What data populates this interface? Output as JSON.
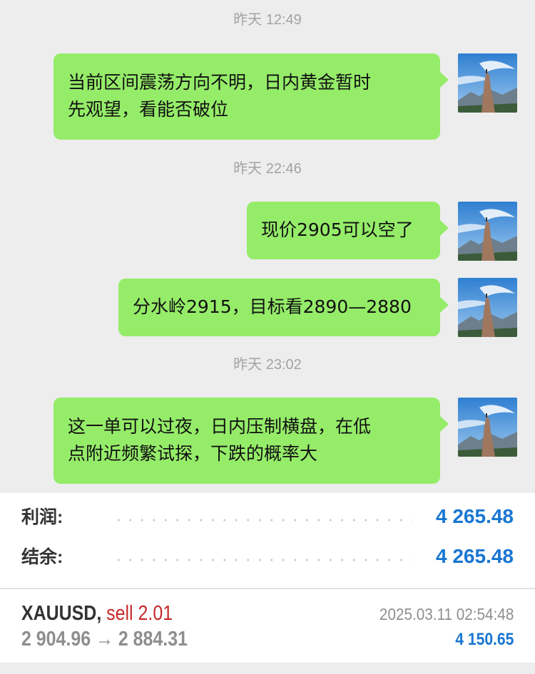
{
  "chat": {
    "timestamps": [
      "昨天 12:49",
      "昨天 22:46",
      "昨天 23:02"
    ],
    "messages": [
      {
        "lines": [
          "当前区间震荡方向不明，日内黄金暂时",
          "先观望，看能否破位"
        ]
      },
      {
        "lines": [
          "现价2905可以空了"
        ]
      },
      {
        "lines": [
          "分水岭2915，目标看2890—2880"
        ]
      },
      {
        "lines": [
          "这一单可以过夜，日内压制横盘，在低",
          "点附近频繁试探，下跌的概率大"
        ]
      }
    ],
    "bubble_color": "#95ec69"
  },
  "account": {
    "profit_label": "利润:",
    "profit_value": "4 265.48",
    "balance_label": "结余:",
    "balance_value": "4 265.48",
    "value_color": "#1976d2"
  },
  "trade": {
    "symbol": "XAUUSD,",
    "side": "sell 2.01",
    "prices": "2 904.96 → 2 884.31",
    "time": "2025.03.11 02:54:48",
    "profit": "4 150.65",
    "side_color": "#c62828"
  }
}
